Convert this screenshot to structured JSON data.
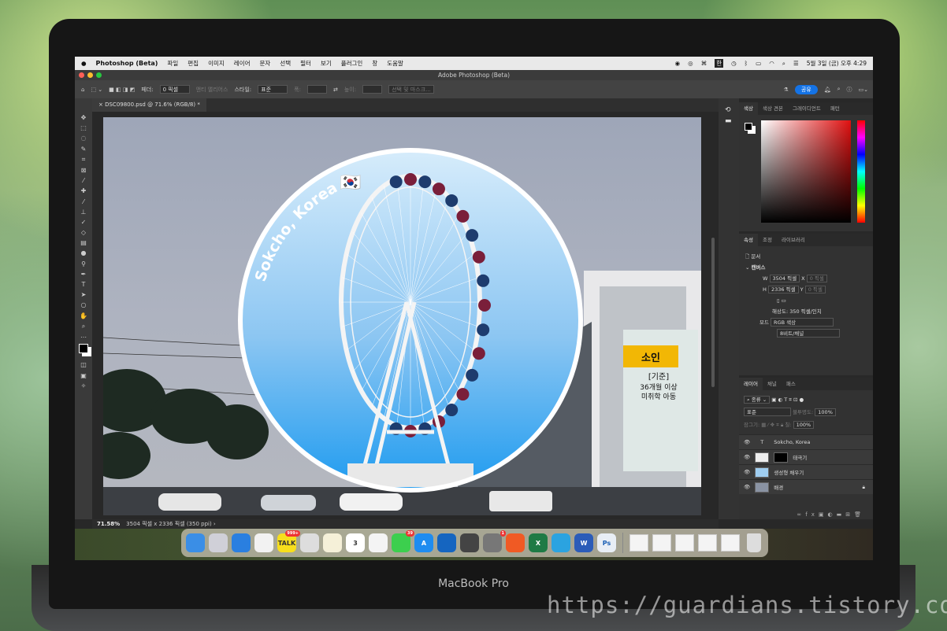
{
  "menubar": {
    "app": "Photoshop (Beta)",
    "items": [
      "파일",
      "편집",
      "이미지",
      "레이어",
      "문자",
      "선택",
      "필터",
      "보기",
      "플러그인",
      "창",
      "도움말"
    ],
    "clock": "5월 3일 (금) 오후 4:29",
    "ime": "한"
  },
  "window": {
    "title": "Adobe Photoshop (Beta)"
  },
  "options": {
    "feather_label": "페더:",
    "feather_value": "0 픽셀",
    "antialias": "앤티 앨리어스",
    "style_label": "스타일:",
    "style_value": "표준",
    "width_label": "폭:",
    "height_label": "높이:",
    "select_mask": "선택 및 마스크...",
    "share": "공유"
  },
  "document": {
    "tab": "DSC09800.psd @ 71.6% (RGB/8) *"
  },
  "image": {
    "text": "Sokcho, Korea",
    "flag": "🇰🇷",
    "sign": {
      "title": "소인",
      "line1": "[기준]",
      "line2": "36개월 이상",
      "line3": "미취학 아동"
    }
  },
  "status": {
    "zoom": "71.58%",
    "info": "3504 픽셀 x 2336 픽셀 (350 ppi)"
  },
  "color_panel": {
    "tabs": [
      "색상",
      "색상 견본",
      "그레이디언트",
      "패턴"
    ]
  },
  "properties": {
    "tabs": [
      "속성",
      "조정",
      "라이브러리"
    ],
    "doc": "문서",
    "section": "캔버스",
    "w_label": "W",
    "w": "3504 픽셀",
    "h_label": "H",
    "h": "2336 픽셀",
    "x_label": "X",
    "x": "0 픽셀",
    "y_label": "Y",
    "y": "0 픽셀",
    "resolution": "해상도: 350 픽셀/인치",
    "mode_label": "모드",
    "mode": "RGB 색상",
    "depth": "8비트/채널"
  },
  "layers": {
    "tabs": [
      "레이어",
      "채널",
      "패스"
    ],
    "filter": "종류",
    "blend": "표준",
    "opacity_label": "불투명도:",
    "opacity": "100%",
    "lock_label": "잠그기:",
    "fill_label": "칠:",
    "fill": "100%",
    "items": [
      {
        "name": "Sokcho, Korea",
        "type": "text"
      },
      {
        "name": "태극기",
        "type": "smart"
      },
      {
        "name": "생성형 채우기",
        "type": "image"
      },
      {
        "name": "배경",
        "type": "background",
        "locked": true
      }
    ]
  },
  "dock": {
    "apps": [
      {
        "name": "Finder",
        "color": "#3a8ee6"
      },
      {
        "name": "Launchpad",
        "color": "#d0d0d8"
      },
      {
        "name": "Safari",
        "color": "#2a7fe0"
      },
      {
        "name": "Chrome",
        "color": "#f2f2f2"
      },
      {
        "name": "KakaoTalk",
        "color": "#f7de1c",
        "label": "TALK",
        "badge": "999+"
      },
      {
        "name": "Pinwheel",
        "color": "#ddd"
      },
      {
        "name": "Notes",
        "color": "#f5f0d8"
      },
      {
        "name": "Calendar",
        "color": "#fff",
        "label": "3"
      },
      {
        "name": "TextEdit",
        "color": "#f4f4f4"
      },
      {
        "name": "Messages",
        "color": "#3ccf4e",
        "badge": "39"
      },
      {
        "name": "App Store",
        "color": "#1e8cf0",
        "label": "A"
      },
      {
        "name": "Files",
        "color": "#1565c0"
      },
      {
        "name": "Final Cut Pro",
        "color": "#444"
      },
      {
        "name": "System Settings",
        "color": "#777",
        "badge": "1"
      },
      {
        "name": "Brave",
        "color": "#f05a24"
      },
      {
        "name": "Excel",
        "color": "#1e7a45",
        "label": "X"
      },
      {
        "name": "Telegram",
        "color": "#2ba3e0"
      },
      {
        "name": "Word",
        "color": "#2b5cb8",
        "label": "W"
      },
      {
        "name": "Photoshop",
        "color": "#e8eef5",
        "label": "Ps"
      }
    ]
  },
  "laptop": {
    "model": "MacBook Pro"
  },
  "watermark": "https://guardians.tistory.com/"
}
